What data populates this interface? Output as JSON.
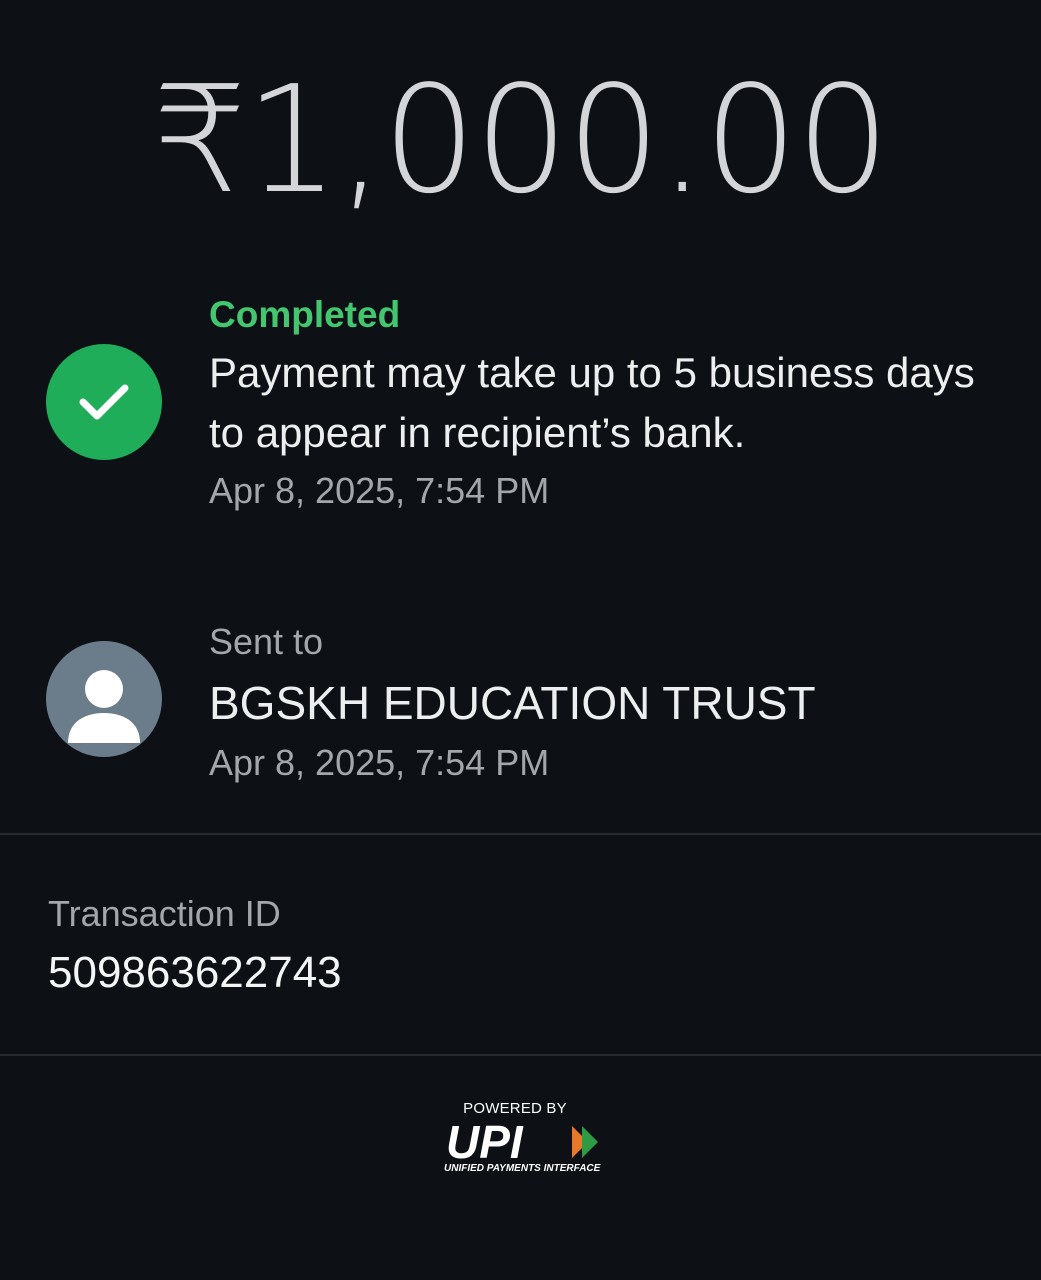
{
  "amount": "₹1,000.00",
  "status": {
    "label": "Completed",
    "message": "Payment may take up to 5 business days to appear in recipient’s bank.",
    "timestamp": "Apr 8, 2025, 7:54 PM",
    "color": "#1fad5a",
    "icon": "check-icon"
  },
  "recipient": {
    "label": "Sent to",
    "name": "BGSKH EDUCATION TRUST",
    "timestamp": "Apr 8, 2025, 7:54 PM",
    "icon": "person-avatar-icon"
  },
  "transaction": {
    "label": "Transaction ID",
    "id": "509863622743"
  },
  "footer": {
    "powered_by": "POWERED BY",
    "logo_text": "UPI",
    "logo_subtitle": "UNIFIED PAYMENTS INTERFACE"
  }
}
